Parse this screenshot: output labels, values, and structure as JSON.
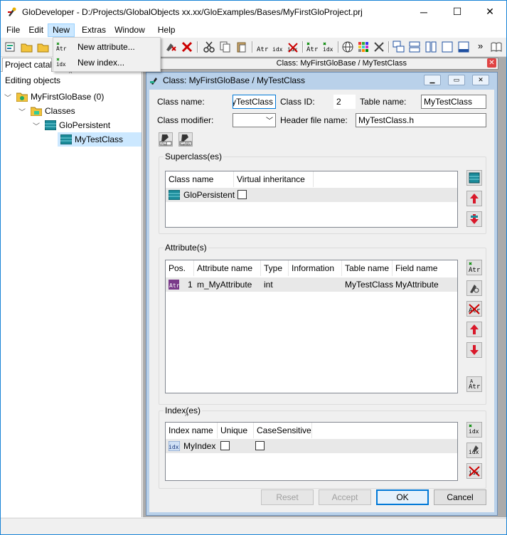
{
  "window": {
    "title": "GloDeveloper - D:/Projects/GlobalObjects xx.xx/GloExamples/Bases/MyFirstGloProject.prj",
    "minimize": "─",
    "maximize": "☐",
    "close": "✕"
  },
  "menubar": {
    "file": "File",
    "edit": "Edit",
    "new": "New",
    "extras": "Extras",
    "window": "Window",
    "help": "Help"
  },
  "dropdown": {
    "new_attribute": "New attribute...",
    "new_index": "New index..."
  },
  "toolbar": {
    "overflow": "»"
  },
  "left_panel": {
    "tab_label": "Project catal",
    "section_label": "Editing objects",
    "tree": {
      "base": "MyFirstGloBase (0)",
      "classes": "Classes",
      "persistent": "GloPersistent",
      "my_class": "MyTestClass"
    }
  },
  "doc_tab": {
    "label": "Class: MyFirstGloBase / MyTestClass"
  },
  "child_window": {
    "title": "Class: MyFirstGloBase / MyTestClass",
    "form": {
      "class_name_label": "Class name:",
      "class_name_value": "MyTestClass",
      "class_id_label": "Class ID:",
      "class_id_value": "2",
      "table_name_label": "Table name:",
      "table_name_value": "MyTestClass",
      "class_modifier_label": "Class modifier:",
      "class_modifier_value": "",
      "header_file_label": "Header file name:",
      "header_file_value": "MyTestClass.h",
      "file_icon_label": "FILE",
      "class_icon_label": "CLASS"
    },
    "superclass": {
      "title": "Superclass(es)",
      "columns": [
        "Class name",
        "Virtual inheritance"
      ],
      "rows": [
        {
          "class_name": "GloPersistent",
          "virtual": false
        }
      ]
    },
    "attributes": {
      "title": "Attribute(s)",
      "columns": [
        "Pos.",
        "Attribute name",
        "Type",
        "Information",
        "Table name",
        "Field name"
      ],
      "rows": [
        {
          "pos": "1",
          "name": "m_MyAttribute",
          "type": "int",
          "info": "",
          "table": "MyTestClass",
          "field": "MyAttribute"
        }
      ]
    },
    "indexes": {
      "title": "Index(es)",
      "columns": [
        "Index name",
        "Unique",
        "CaseSensitive"
      ],
      "rows": [
        {
          "name": "MyIndex",
          "unique": false,
          "case_sensitive": false
        }
      ]
    },
    "buttons": {
      "reset": "Reset",
      "accept": "Accept",
      "ok": "OK",
      "cancel": "Cancel"
    }
  },
  "colors": {
    "accent": "#0078d7",
    "selection": "#cce8ff",
    "mdi_bg": "#ababab",
    "child_frame": "#b9d1ea",
    "class_icon": "#1a8a99"
  }
}
